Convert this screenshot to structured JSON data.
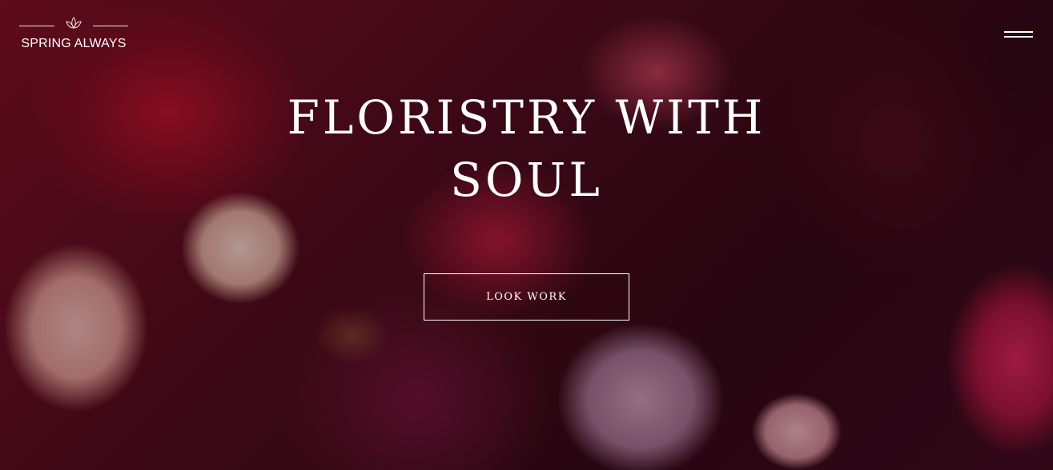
{
  "brand": {
    "name": "SPRING ALWAYS",
    "logo_icon": "lotus-icon"
  },
  "header": {
    "menu_icon": "hamburger-menu-icon"
  },
  "hero": {
    "headline_line1": "FLORISTRY WITH",
    "headline_line2": "SOUL",
    "cta_label": "LOOK WORK",
    "background": "flower-bouquet-photo"
  },
  "colors": {
    "text": "#ffffff",
    "overlay": "#2a0a12"
  }
}
